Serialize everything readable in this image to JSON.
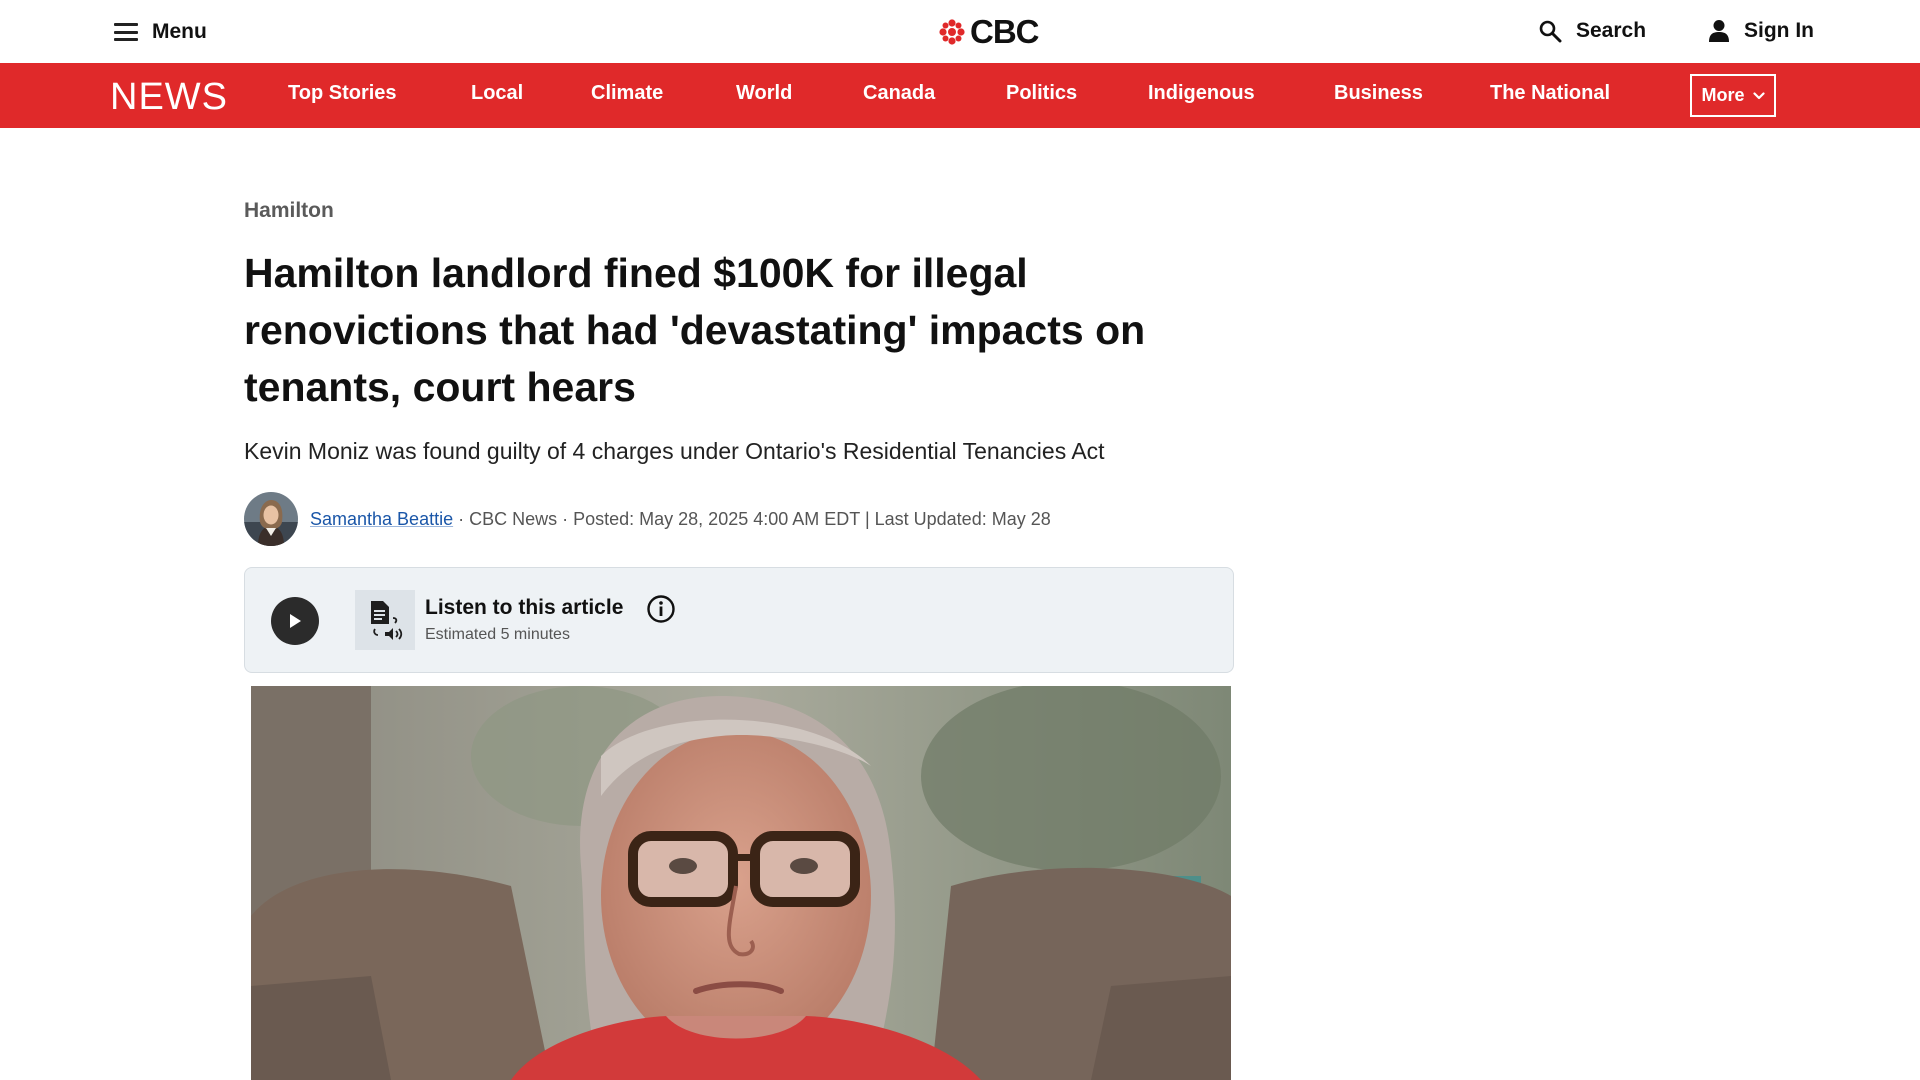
{
  "header": {
    "menu_label": "Menu",
    "logo_text": "CBC",
    "search_label": "Search",
    "signin_label": "Sign In",
    "icons": [
      "hamburger-icon",
      "cbc-gem-icon",
      "search-icon",
      "user-icon"
    ]
  },
  "nav": {
    "brand": "NEWS",
    "items": [
      {
        "label": "Top Stories"
      },
      {
        "label": "Local"
      },
      {
        "label": "Climate"
      },
      {
        "label": "World"
      },
      {
        "label": "Canada"
      },
      {
        "label": "Politics"
      },
      {
        "label": "Indigenous"
      },
      {
        "label": "Business"
      },
      {
        "label": "The National"
      }
    ],
    "more_label": "More",
    "bar_color": "#e0292a"
  },
  "article": {
    "section": "Hamilton",
    "headline": "Hamilton landlord fined $100K for illegal renovictions that had 'devastating' impacts on tenants, court hears",
    "dek": "Kevin Moniz was found guilty of 4 charges under Ontario's Residential Tenancies Act",
    "author": "Samantha Beattie",
    "meta": " · CBC News · Posted: May 28, 2025 4:00 AM EDT | Last Updated: May 28",
    "author_link_color": "#1a56a8"
  },
  "listen": {
    "title": "Listen to this article",
    "subtitle": "Estimated 5 minutes",
    "icons": [
      "play-icon",
      "text-to-speech-icon",
      "info-icon"
    ]
  }
}
